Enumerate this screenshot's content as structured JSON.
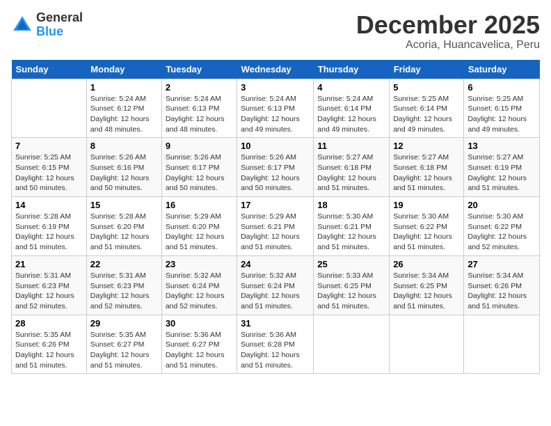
{
  "logo": {
    "general": "General",
    "blue": "Blue"
  },
  "title": {
    "month": "December 2025",
    "location": "Acoria, Huancavelica, Peru"
  },
  "headers": [
    "Sunday",
    "Monday",
    "Tuesday",
    "Wednesday",
    "Thursday",
    "Friday",
    "Saturday"
  ],
  "weeks": [
    [
      {
        "day": "",
        "info": ""
      },
      {
        "day": "1",
        "info": "Sunrise: 5:24 AM\nSunset: 6:12 PM\nDaylight: 12 hours\nand 48 minutes."
      },
      {
        "day": "2",
        "info": "Sunrise: 5:24 AM\nSunset: 6:13 PM\nDaylight: 12 hours\nand 48 minutes."
      },
      {
        "day": "3",
        "info": "Sunrise: 5:24 AM\nSunset: 6:13 PM\nDaylight: 12 hours\nand 49 minutes."
      },
      {
        "day": "4",
        "info": "Sunrise: 5:24 AM\nSunset: 6:14 PM\nDaylight: 12 hours\nand 49 minutes."
      },
      {
        "day": "5",
        "info": "Sunrise: 5:25 AM\nSunset: 6:14 PM\nDaylight: 12 hours\nand 49 minutes."
      },
      {
        "day": "6",
        "info": "Sunrise: 5:25 AM\nSunset: 6:15 PM\nDaylight: 12 hours\nand 49 minutes."
      }
    ],
    [
      {
        "day": "7",
        "info": "Sunrise: 5:25 AM\nSunset: 6:15 PM\nDaylight: 12 hours\nand 50 minutes."
      },
      {
        "day": "8",
        "info": "Sunrise: 5:26 AM\nSunset: 6:16 PM\nDaylight: 12 hours\nand 50 minutes."
      },
      {
        "day": "9",
        "info": "Sunrise: 5:26 AM\nSunset: 6:17 PM\nDaylight: 12 hours\nand 50 minutes."
      },
      {
        "day": "10",
        "info": "Sunrise: 5:26 AM\nSunset: 6:17 PM\nDaylight: 12 hours\nand 50 minutes."
      },
      {
        "day": "11",
        "info": "Sunrise: 5:27 AM\nSunset: 6:18 PM\nDaylight: 12 hours\nand 51 minutes."
      },
      {
        "day": "12",
        "info": "Sunrise: 5:27 AM\nSunset: 6:18 PM\nDaylight: 12 hours\nand 51 minutes."
      },
      {
        "day": "13",
        "info": "Sunrise: 5:27 AM\nSunset: 6:19 PM\nDaylight: 12 hours\nand 51 minutes."
      }
    ],
    [
      {
        "day": "14",
        "info": "Sunrise: 5:28 AM\nSunset: 6:19 PM\nDaylight: 12 hours\nand 51 minutes."
      },
      {
        "day": "15",
        "info": "Sunrise: 5:28 AM\nSunset: 6:20 PM\nDaylight: 12 hours\nand 51 minutes."
      },
      {
        "day": "16",
        "info": "Sunrise: 5:29 AM\nSunset: 6:20 PM\nDaylight: 12 hours\nand 51 minutes."
      },
      {
        "day": "17",
        "info": "Sunrise: 5:29 AM\nSunset: 6:21 PM\nDaylight: 12 hours\nand 51 minutes."
      },
      {
        "day": "18",
        "info": "Sunrise: 5:30 AM\nSunset: 6:21 PM\nDaylight: 12 hours\nand 51 minutes."
      },
      {
        "day": "19",
        "info": "Sunrise: 5:30 AM\nSunset: 6:22 PM\nDaylight: 12 hours\nand 51 minutes."
      },
      {
        "day": "20",
        "info": "Sunrise: 5:30 AM\nSunset: 6:22 PM\nDaylight: 12 hours\nand 52 minutes."
      }
    ],
    [
      {
        "day": "21",
        "info": "Sunrise: 5:31 AM\nSunset: 6:23 PM\nDaylight: 12 hours\nand 52 minutes."
      },
      {
        "day": "22",
        "info": "Sunrise: 5:31 AM\nSunset: 6:23 PM\nDaylight: 12 hours\nand 52 minutes."
      },
      {
        "day": "23",
        "info": "Sunrise: 5:32 AM\nSunset: 6:24 PM\nDaylight: 12 hours\nand 52 minutes."
      },
      {
        "day": "24",
        "info": "Sunrise: 5:32 AM\nSunset: 6:24 PM\nDaylight: 12 hours\nand 51 minutes."
      },
      {
        "day": "25",
        "info": "Sunrise: 5:33 AM\nSunset: 6:25 PM\nDaylight: 12 hours\nand 51 minutes."
      },
      {
        "day": "26",
        "info": "Sunrise: 5:34 AM\nSunset: 6:25 PM\nDaylight: 12 hours\nand 51 minutes."
      },
      {
        "day": "27",
        "info": "Sunrise: 5:34 AM\nSunset: 6:26 PM\nDaylight: 12 hours\nand 51 minutes."
      }
    ],
    [
      {
        "day": "28",
        "info": "Sunrise: 5:35 AM\nSunset: 6:26 PM\nDaylight: 12 hours\nand 51 minutes."
      },
      {
        "day": "29",
        "info": "Sunrise: 5:35 AM\nSunset: 6:27 PM\nDaylight: 12 hours\nand 51 minutes."
      },
      {
        "day": "30",
        "info": "Sunrise: 5:36 AM\nSunset: 6:27 PM\nDaylight: 12 hours\nand 51 minutes."
      },
      {
        "day": "31",
        "info": "Sunrise: 5:36 AM\nSunset: 6:28 PM\nDaylight: 12 hours\nand 51 minutes."
      },
      {
        "day": "",
        "info": ""
      },
      {
        "day": "",
        "info": ""
      },
      {
        "day": "",
        "info": ""
      }
    ]
  ]
}
